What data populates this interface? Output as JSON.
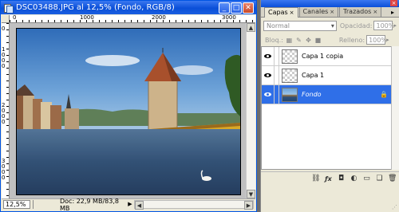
{
  "document": {
    "title": "DSC03488.JPG al 12,5% (Fondo, RGB/8)",
    "window_buttons": [
      "_",
      "□",
      "✕"
    ],
    "ruler_h_labels": [
      "0",
      "1000",
      "2000",
      "3000"
    ],
    "ruler_v_labels": [
      "0",
      "1000",
      "2000",
      "3000"
    ],
    "status": {
      "zoom": "12,5%",
      "doc_info": "Doc: 22,9 MB/83,8 MB"
    },
    "colors": {
      "titlebar": "#0a4fd8",
      "canvas_bg": "#c0c0c0"
    }
  },
  "layers_panel": {
    "tabs": [
      {
        "label": "Capas",
        "active": true
      },
      {
        "label": "Canales",
        "active": false
      },
      {
        "label": "Trazados",
        "active": false
      }
    ],
    "tab_close": "×",
    "menu_arrow": "▸",
    "blend_mode": "Normal",
    "opacity_label": "Opacidad:",
    "opacity_value": "100%",
    "lock_label": "Bloq.:",
    "fill_label": "Relleno:",
    "fill_value": "100%",
    "layers": [
      {
        "name": "Capa 1 copia",
        "selected": false,
        "visible": true,
        "thumb": "transparent"
      },
      {
        "name": "Capa 1",
        "selected": false,
        "visible": true,
        "thumb": "transparent"
      },
      {
        "name": "Fondo",
        "selected": true,
        "visible": true,
        "thumb": "photo",
        "locked": true
      }
    ],
    "lock_icon": "🔒",
    "bottom_icons": [
      "link-icon",
      "fx-icon",
      "mask-icon",
      "adjustment-icon",
      "group-icon",
      "new-layer-icon",
      "trash-icon"
    ],
    "colors": {
      "selected_row": "#2f6fe8"
    }
  }
}
